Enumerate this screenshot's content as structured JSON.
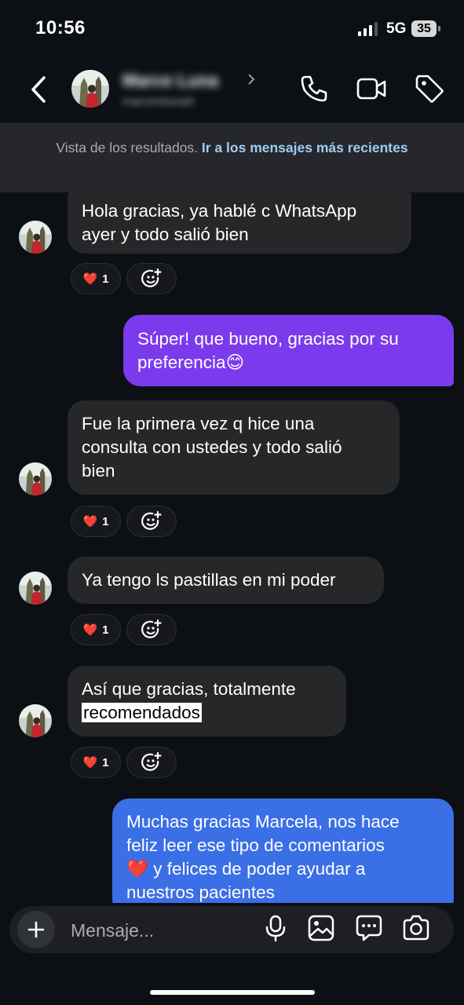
{
  "status_bar": {
    "time": "10:56",
    "network": "5G",
    "battery": "35"
  },
  "header": {
    "contact_name": "Marce Luna",
    "contact_username": "marcemluna9"
  },
  "banner": {
    "text": "Vista de los resultados.",
    "link": "Ir a los mensajes más recientes"
  },
  "messages": [
    {
      "side": "in",
      "text_lines": [
        "Hola gracias, ya hablé c WhatsApp",
        "ayer y todo salió bien"
      ],
      "reaction": {
        "emoji": "❤️",
        "count": "1"
      }
    },
    {
      "side": "out",
      "text_lines": [
        "Súper! que bueno, gracias por su",
        "preferencia😊"
      ]
    },
    {
      "side": "in",
      "text_lines": [
        "Fue la primera vez q hice una",
        "consulta con ustedes y todo salió",
        "bien"
      ],
      "reaction": {
        "emoji": "❤️",
        "count": "1"
      }
    },
    {
      "side": "in",
      "text_lines": [
        "Ya tengo ls pastillas en mi poder"
      ],
      "reaction": {
        "emoji": "❤️",
        "count": "1"
      }
    },
    {
      "side": "in",
      "text_lines": [
        "Así que gracias, totalmente",
        "recomendados"
      ],
      "highlight": "recomendados",
      "reaction": {
        "emoji": "❤️",
        "count": "1"
      }
    },
    {
      "side": "out",
      "text_lines": [
        "Muchas gracias Marcela, nos hace",
        "feliz leer ese tipo de comentarios",
        "❤️  y felices de poder ayudar a",
        "nuestros pacientes"
      ]
    }
  ],
  "composer": {
    "placeholder": "Mensaje..."
  },
  "icons": {
    "back": "chevron-left-icon",
    "call": "phone-icon",
    "video": "video-camera-icon",
    "tag": "tag-icon",
    "add_reaction": "add-emoji-icon",
    "plus": "plus-icon",
    "mic": "microphone-icon",
    "gallery": "image-icon",
    "sticker": "chat-bubble-icon",
    "camera": "camera-icon"
  },
  "colors": {
    "background": "#0c0f14",
    "incoming_bubble": "#262729",
    "outgoing_purple": "#7c3aed",
    "outgoing_blue": "#3b6fe6",
    "link": "#9fcdf1"
  }
}
